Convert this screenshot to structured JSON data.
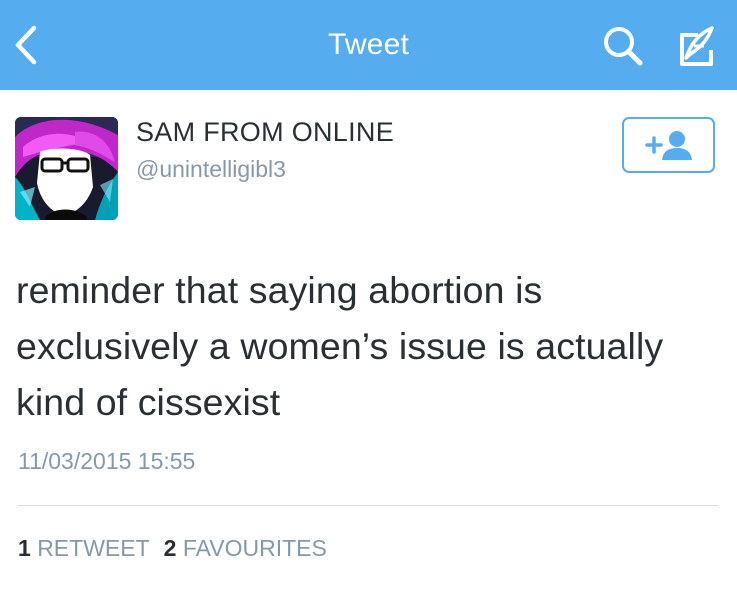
{
  "navbar": {
    "title": "Tweet",
    "back_icon": "chevron-left-icon",
    "search_icon": "search-icon",
    "compose_icon": "compose-icon",
    "background": "#55acee"
  },
  "author": {
    "display_name": "SAM FROM ONLINE",
    "username": "@unintelligibl3",
    "follow_icon": "add-user-icon"
  },
  "tweet": {
    "text": "reminder that saying abortion is exclusively a women’s issue is actually kind of cissexist",
    "timestamp": "11/03/2015 15:55"
  },
  "stats": {
    "retweets_count": "1",
    "retweets_label": "RETWEET",
    "favourites_count": "2",
    "favourites_label": "FAVOURITES"
  },
  "colors": {
    "accent": "#55acee",
    "text_primary": "#292f33",
    "text_secondary": "#8899a6"
  }
}
